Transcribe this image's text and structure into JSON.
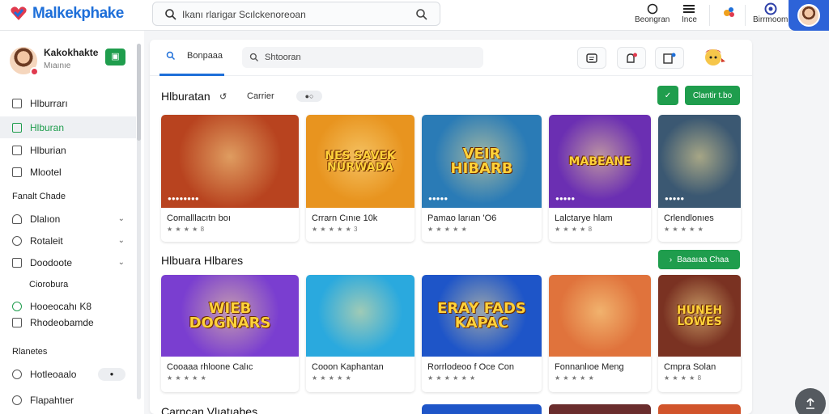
{
  "app": {
    "logo_text": "Malkekphake",
    "brand_color": "#1e6fd9",
    "accent_color": "#1f9d4d"
  },
  "topbar": {
    "search_text": "Ikanı rlarigar Scılckenoreoan",
    "nav": [
      {
        "label": "Beongran",
        "icon": "circle-icon"
      },
      {
        "label": "Ince",
        "icon": "menu-icon"
      }
    ],
    "right_badge_label": "Birrmoom",
    "icons": [
      "search-icon",
      "search-icon",
      "notification-icon",
      "globe-icon",
      "avatar"
    ]
  },
  "sidebar": {
    "user": {
      "name": "Kakokhakte",
      "sub": "Mıaınıe",
      "badge": "▣"
    },
    "items": [
      {
        "label": "Hlburrarı",
        "icon": "home-icon",
        "active": false
      },
      {
        "label": "Hlburan",
        "icon": "grid-icon",
        "active": true
      },
      {
        "label": "Hlburian",
        "icon": "square-icon",
        "active": false
      },
      {
        "label": "Mlootel",
        "icon": "bookmark-icon",
        "active": false
      }
    ],
    "section1": "Fanalt Chade",
    "group": [
      {
        "label": "Dlalıon",
        "icon": "user-icon"
      },
      {
        "label": "Rotaleit",
        "icon": "gear-icon"
      },
      {
        "label": "Doodoote",
        "icon": "document-icon"
      }
    ],
    "subitem": "Ciorobura",
    "extra": [
      {
        "label": "Hooeocahı K8",
        "icon": "check-icon"
      },
      {
        "label": "Rhodeobamde",
        "icon": "list-icon"
      }
    ],
    "section2": "Rlanetes",
    "bottom": [
      {
        "label": "Hotleoaalo",
        "icon": "chat-icon",
        "pill": "●"
      },
      {
        "label": "Flapahtıer",
        "icon": "info-icon"
      }
    ]
  },
  "main": {
    "tab_label": "Bonpaaa",
    "search_placeholder": "Shtooran",
    "sections": [
      {
        "title": "Hlburatan",
        "chip": "Carrier",
        "pill": "●○",
        "button": "Clantir t.bo",
        "cards": [
          {
            "title": "Comalllacıtn boı",
            "tag": "●●●●●●●●",
            "rating": "★ ★ ★ ★ 8",
            "art": "",
            "bg": "#b8431f"
          },
          {
            "title": "Crrarn Cınıe 10k",
            "tag": "",
            "rating": "★ ★ ★ ★ ★ 3",
            "art": "NES SAVEK NURWADA",
            "bg": "#e8941f"
          },
          {
            "title": "Pamao larıan 'O6",
            "tag": "●●●●●",
            "rating": "★ ★ ★ ★ ★",
            "art": "VEIR HIBARB",
            "bg": "#2a7bb6"
          },
          {
            "title": "Lalctarye hlam",
            "tag": "●●●●●",
            "rating": "★ ★ ★ ★ 8",
            "art": "MABEANE",
            "bg": "#6b2fb2"
          },
          {
            "title": "Crlendlonıes",
            "tag": "●●●●●",
            "rating": "★ ★ ★ ★ ★",
            "art": "",
            "bg": "#3b5872"
          }
        ]
      },
      {
        "title": "Hlbuara Hlbares",
        "button": "Baaaıaa Chaa",
        "cards": [
          {
            "title": "Cooaaa rhloone Calıc",
            "tag": "",
            "rating": "★ ★ ★ ★ ★",
            "art": "WIEB DOGNARS",
            "bg": "#7a3ed0"
          },
          {
            "title": "Cooon Kaphantan",
            "tag": "",
            "rating": "★ ★ ★ ★ ★",
            "art": "",
            "bg": "#2aa9de"
          },
          {
            "title": "Rorrlodeoo f Oce Con",
            "tag": "",
            "rating": "★ ★ ★ ★ ★ ★",
            "art": "ERAY FADS KAPAC",
            "bg": "#1e55c8"
          },
          {
            "title": "Fonnanlıoe Meng",
            "tag": "",
            "rating": "★ ★ ★ ★ ★",
            "art": "",
            "bg": "#e0733c"
          },
          {
            "title": "Cmpra Solan",
            "tag": "",
            "rating": "★ ★ ★ ★ 8",
            "art": "HUNEH LOWES",
            "bg": "#7a3222"
          }
        ]
      }
    ],
    "third_section_title": "Carncan Vlıatıabes"
  }
}
